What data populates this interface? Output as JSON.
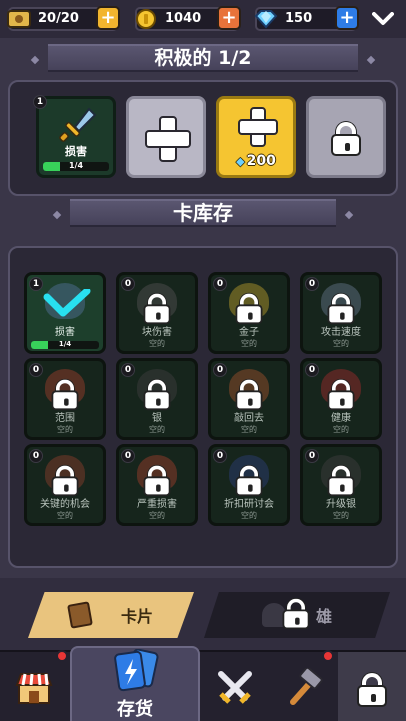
{
  "resources": {
    "energy": "20/20",
    "coins": "1040",
    "gems": "150"
  },
  "active_deck": {
    "title": "积极的",
    "count": "1/2",
    "card": {
      "level": "1",
      "name": "损害",
      "progress_text": "1/4",
      "progress": 0.25
    },
    "buy_slot_price": "200"
  },
  "library": {
    "title": "卡库存",
    "cards": [
      {
        "level": "1",
        "name": "损害",
        "sub": "1/4",
        "owned": true,
        "progress": 0.25
      },
      {
        "level": "0",
        "name": "块伤害",
        "sub": "空的",
        "owned": false
      },
      {
        "level": "0",
        "name": "金子",
        "sub": "空的",
        "owned": false
      },
      {
        "level": "0",
        "name": "攻击速度",
        "sub": "空的",
        "owned": false
      },
      {
        "level": "0",
        "name": "范围",
        "sub": "空的",
        "owned": false
      },
      {
        "level": "0",
        "name": "银",
        "sub": "空的",
        "owned": false
      },
      {
        "level": "0",
        "name": "敲回去",
        "sub": "空的",
        "owned": false
      },
      {
        "level": "0",
        "name": "健康",
        "sub": "空的",
        "owned": false
      },
      {
        "level": "0",
        "name": "关键的机会",
        "sub": "空的",
        "owned": false
      },
      {
        "level": "0",
        "name": "严重损害",
        "sub": "空的",
        "owned": false
      },
      {
        "level": "0",
        "name": "折扣研讨会",
        "sub": "空的",
        "owned": false
      },
      {
        "level": "0",
        "name": "升级银",
        "sub": "空的",
        "owned": false
      }
    ]
  },
  "tabs": {
    "cards": "卡片",
    "heroes": "雄"
  },
  "nav": {
    "inventory": "存货"
  },
  "colors": {
    "background": "#3a3648",
    "accent_gold": "#f5c531",
    "card_green": "#1d3f2c",
    "progress_green": "#38d25a"
  }
}
